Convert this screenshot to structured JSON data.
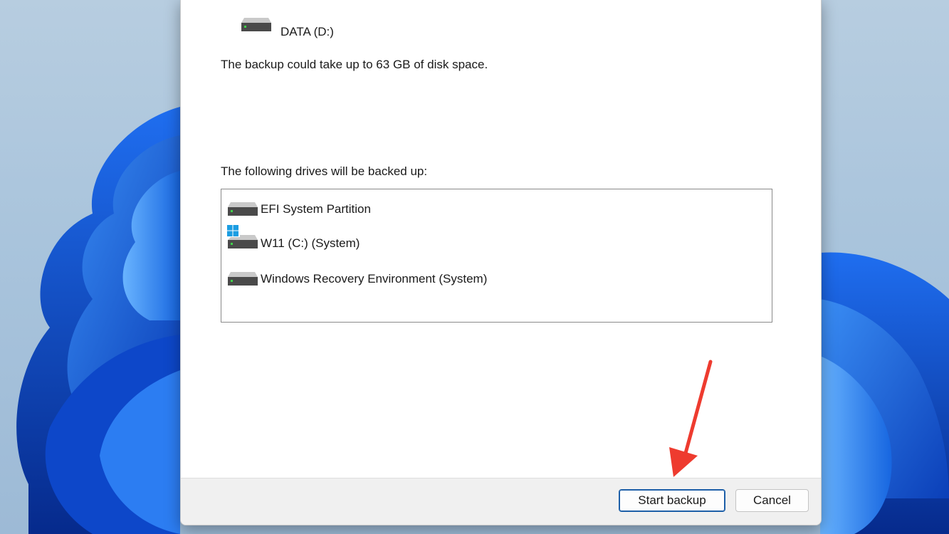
{
  "dialog": {
    "destination_drive_label": "DATA (D:)",
    "space_message": "The backup could take up to 63 GB of disk space.",
    "drives_heading": "The following drives will be backed up:",
    "drives": [
      {
        "label": "EFI System Partition",
        "icon": "hard-drive-icon"
      },
      {
        "label": "W11 (C:) (System)",
        "icon": "windows-system-drive-icon"
      },
      {
        "label": "Windows Recovery Environment (System)",
        "icon": "hard-drive-icon"
      }
    ]
  },
  "footer": {
    "start_label": "Start backup",
    "cancel_label": "Cancel"
  },
  "annotation": {
    "arrow_color": "#ee3b2f",
    "points_to": "start-backup-button"
  },
  "colors": {
    "accent": "#1d5fa8",
    "wallpaper_blue": "#1a5fe0"
  }
}
